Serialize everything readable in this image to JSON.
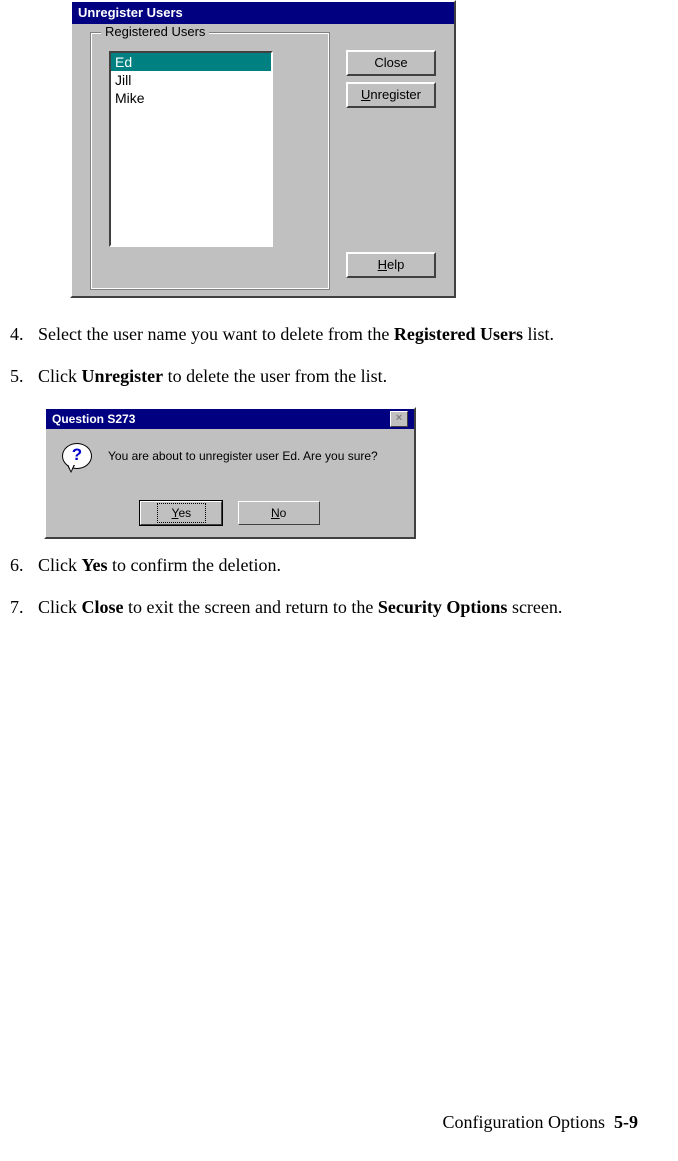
{
  "dialog1": {
    "title": "Unregister Users",
    "group_label": "Registered Users",
    "users": [
      "Ed",
      "Jill",
      "Mike"
    ],
    "selected_index": 0,
    "buttons": {
      "close": "Close",
      "unregister_pre": "U",
      "unregister_post": "nregister",
      "help_pre": "H",
      "help_post": "elp"
    }
  },
  "steps": {
    "s4": {
      "num": "4.",
      "a": "Select the user name you want to delete from the ",
      "b": "Registered Users",
      "c": " list."
    },
    "s5": {
      "num": "5.",
      "a": "Click ",
      "b": "Unregister",
      "c": " to delete the user from the list."
    },
    "s6": {
      "num": "6.",
      "a": "Click ",
      "b": "Yes",
      "c": " to confirm the deletion."
    },
    "s7": {
      "num": "7.",
      "a": "Click ",
      "b": "Close",
      "c": " to exit the screen and return to the ",
      "d": "Security Options",
      "e": " screen."
    }
  },
  "dialog2": {
    "title": "Question S273",
    "message": "You are about to unregister user Ed. Are you sure?",
    "yes_pre": "Y",
    "yes_post": "es",
    "no_pre": "N",
    "no_post": "o"
  },
  "footer": {
    "section": "Configuration Options",
    "page": "5-9"
  }
}
